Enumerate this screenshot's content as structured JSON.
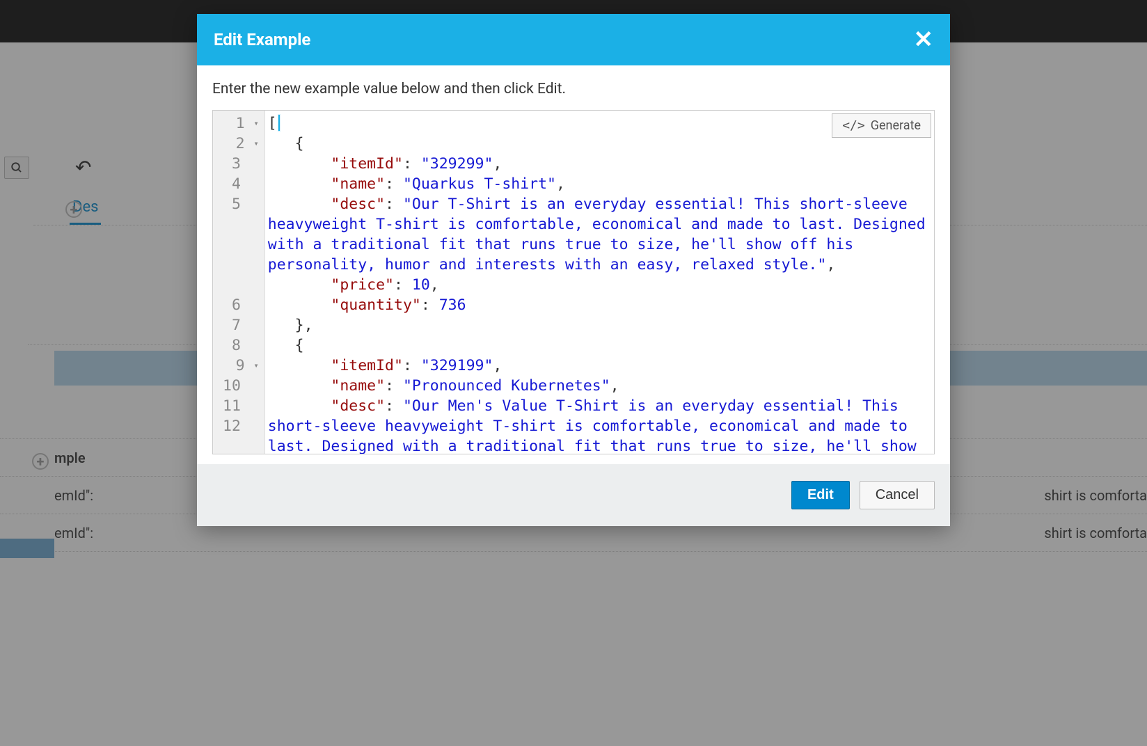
{
  "modal": {
    "title": "Edit Example",
    "instruction": "Enter the new example value below and then click Edit.",
    "generate_label": "Generate",
    "edit_label": "Edit",
    "cancel_label": "Cancel"
  },
  "editor": {
    "line_numbers": [
      "1",
      "2",
      "3",
      "4",
      "5",
      "6",
      "7",
      "8",
      "9",
      "10",
      "11",
      "12"
    ],
    "fold_markers": {
      "1": true,
      "2": true,
      "9": true
    },
    "items": [
      {
        "itemId": "329299",
        "name": "Quarkus T-shirt",
        "desc": "Our T-Shirt is an everyday essential! This short-sleeve heavyweight T-shirt is comfortable, economical and made to last. Designed with a traditional fit that runs true to size, he'll show off his personality, humor and interests with an easy, relaxed style.",
        "price": 10,
        "quantity": 736
      },
      {
        "itemId": "329199",
        "name": "Pronounced Kubernetes",
        "desc": "Our Men's Value T-Shirt is an everyday essential! This short-sleeve heavyweight T-shirt is comfortable, economical and made to last. Designed with a traditional fit that runs true to size, he'll show off his personality, humor and interests with an easy"
      }
    ]
  },
  "bg": {
    "tab_label": "Des",
    "row_header": "mple",
    "row_cell": "emId\":",
    "right_snippet": "shirt is comforta"
  }
}
